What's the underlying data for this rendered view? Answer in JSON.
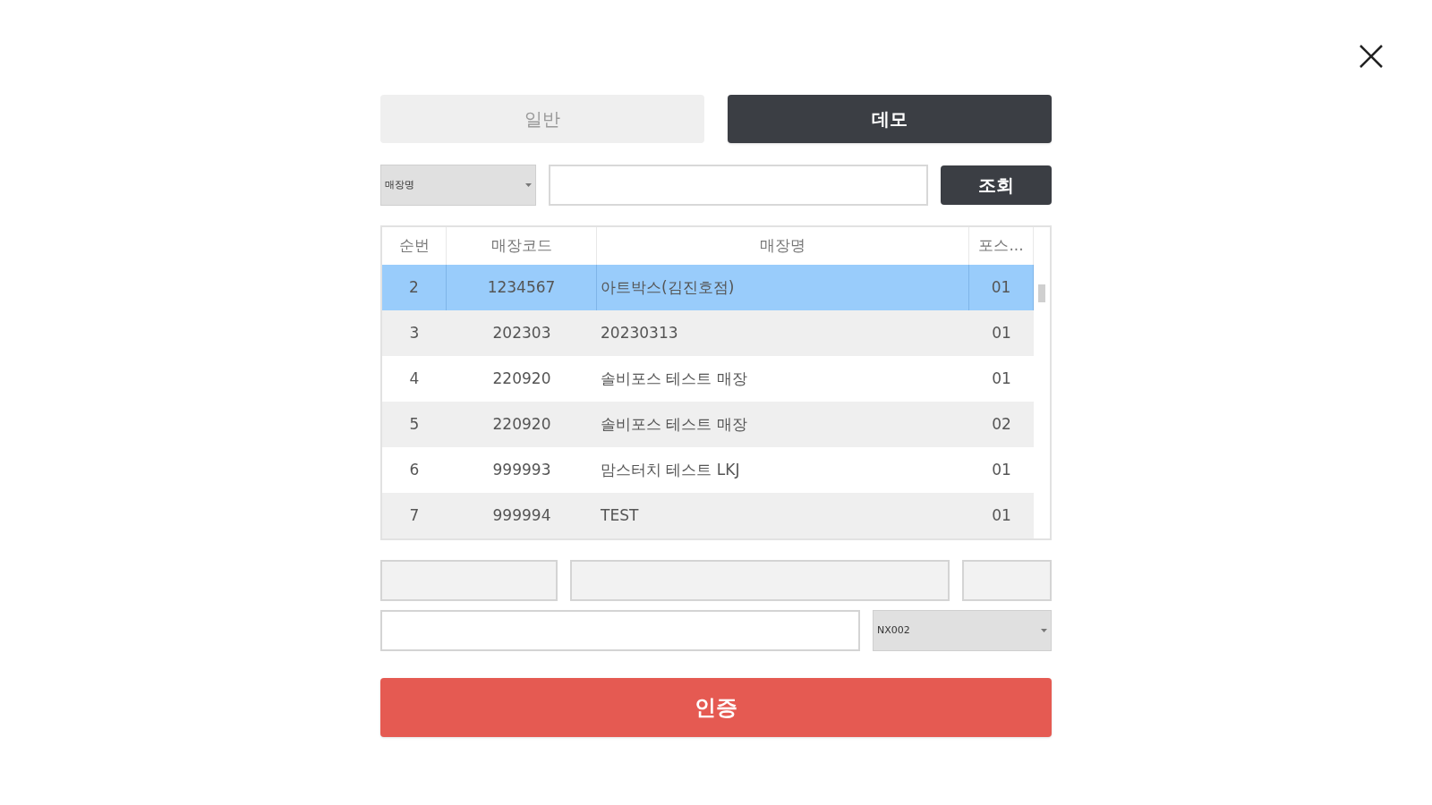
{
  "tabs": [
    {
      "label": "일반",
      "selected": false
    },
    {
      "label": "데모",
      "selected": true
    }
  ],
  "search": {
    "filter": "매장명",
    "button": "조회"
  },
  "table": {
    "columns": [
      "순번",
      "매장코드",
      "매장명",
      "포스..."
    ],
    "rows": [
      {
        "cells": [
          "2",
          "1234567",
          "아트박스(김진호점)",
          "01"
        ],
        "selected": true
      },
      {
        "cells": [
          "3",
          "202303",
          "20230313",
          "01"
        ],
        "selected": false
      },
      {
        "cells": [
          "4",
          "220920",
          "솔비포스 테스트 매장",
          "01"
        ],
        "selected": false
      },
      {
        "cells": [
          "5",
          "220920",
          "솔비포스 테스트 매장",
          "02"
        ],
        "selected": false
      },
      {
        "cells": [
          "6",
          "999993",
          "맘스터치 테스트 LKJ",
          "01"
        ],
        "selected": false
      },
      {
        "cells": [
          "7",
          "999994",
          "TEST",
          "01"
        ],
        "selected": false
      }
    ]
  },
  "device_select": {
    "value": "NX002"
  },
  "submit": "인증"
}
